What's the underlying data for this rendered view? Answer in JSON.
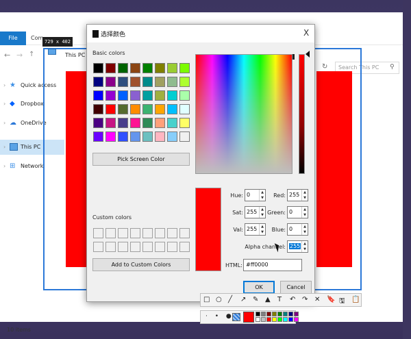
{
  "explorer": {
    "file_tab": "File",
    "computer_tab": "Com",
    "address": "This PC",
    "title_fragment": "This PC",
    "search_placeholder": "Search This PC",
    "status_items": "10 items",
    "sidebar": [
      {
        "label": "Quick access",
        "icon": "star-icon",
        "color": "#3a8ee6"
      },
      {
        "label": "Dropbox",
        "icon": "dropbox-icon",
        "color": "#0061fe"
      },
      {
        "label": "OneDrive",
        "icon": "cloud-icon",
        "color": "#2b78d8"
      },
      {
        "label": "This PC",
        "icon": "computer-icon",
        "color": "#5aa3e6"
      },
      {
        "label": "Network",
        "icon": "network-icon",
        "color": "#3a8ee6"
      }
    ]
  },
  "capture": {
    "dimensions": "729 x 402"
  },
  "dialog": {
    "title": "选择颜色",
    "close": "X",
    "basic_colors_label": "Basic colors",
    "basic_colors": [
      "#000000",
      "#800000",
      "#006400",
      "#8b4513",
      "#008000",
      "#808000",
      "#9acd32",
      "#7cfc00",
      "#000080",
      "#8b008b",
      "#2f4f7f",
      "#a0522d",
      "#008b8b",
      "#a0a060",
      "#8fbc8f",
      "#adff2f",
      "#0000ff",
      "#9400d3",
      "#0060ff",
      "#8a60d0",
      "#00a0a0",
      "#a0b040",
      "#00ced1",
      "#aaffaa",
      "#400000",
      "#ff0000",
      "#556b2f",
      "#ff8c00",
      "#3cb371",
      "#ffa500",
      "#00bfff",
      "#e0ffff",
      "#4b0082",
      "#c71585",
      "#483d8b",
      "#ff1493",
      "#2e8b57",
      "#ffa07a",
      "#48d1cc",
      "#ffff66",
      "#6a00ff",
      "#ff00ff",
      "#3050ff",
      "#6495ed",
      "#6cc0c0",
      "#ffb6c1",
      "#87cefa",
      "#f0f0f0"
    ],
    "pick_screen_color": "Pick Screen Color",
    "custom_colors_label": "Custom colors",
    "add_custom": "Add to Custom Colors",
    "hue_label": "Hue:",
    "hue": "0",
    "sat_label": "Sat:",
    "sat": "255",
    "val_label": "Val:",
    "val": "255",
    "red_label": "Red:",
    "red": "255",
    "green_label": "Green:",
    "green": "0",
    "blue_label": "Blue:",
    "blue": "0",
    "alpha_label": "Alpha channel:",
    "alpha": "255",
    "html_label": "HTML:",
    "html": "#ff0000",
    "ok": "OK",
    "cancel": "Cancel",
    "current_color": "#ff0000"
  },
  "toolbar": {
    "tools_row1": [
      "□",
      "○",
      "╱",
      "↗",
      "✎",
      "▲",
      "T",
      "↶",
      "↷",
      "✕",
      "🔖",
      "🖫",
      "📋"
    ],
    "size_dots": "·  •  ●",
    "current_color": "#ff0000",
    "palette": [
      "#000000",
      "#808080",
      "#800000",
      "#808000",
      "#008000",
      "#008080",
      "#000080",
      "#800080",
      "#ffffff",
      "#c0c0c0",
      "#ff0000",
      "#ffff00",
      "#00ff00",
      "#00ffff",
      "#0000ff",
      "#ff00ff"
    ]
  }
}
